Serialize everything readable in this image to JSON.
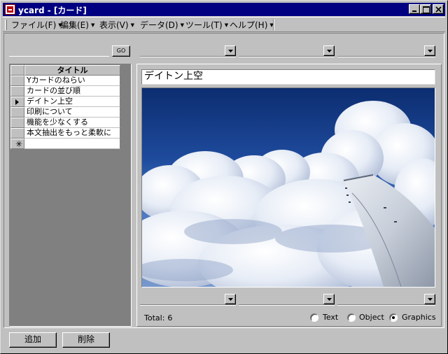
{
  "window": {
    "title": "ycard - [カード]"
  },
  "menu": {
    "items": [
      {
        "label": "ファイル(F)"
      },
      {
        "label": "編集(E)"
      },
      {
        "label": "表示(V)"
      },
      {
        "label": "データ(D)"
      },
      {
        "label": "ツール(T)"
      },
      {
        "label": "ヘルプ(H)"
      }
    ]
  },
  "search": {
    "value": "",
    "go_label": "GO"
  },
  "grid": {
    "column_header": "タイトル",
    "rows": [
      {
        "title": "Yカードのねらい"
      },
      {
        "title": "カードの並び順"
      },
      {
        "title": "デイトン上空"
      },
      {
        "title": "印刷について"
      },
      {
        "title": "機能を少なくする"
      },
      {
        "title": "本文抽出をもっと柔軟に"
      }
    ],
    "current_row": 3,
    "new_row_marker": "✳"
  },
  "detail": {
    "title_value": "デイトン上空",
    "content_type": "Graphics"
  },
  "status": {
    "total_label": "Total:",
    "total_value": "6"
  },
  "view_options": [
    {
      "label": "Text",
      "checked": false
    },
    {
      "label": "Object",
      "checked": false
    },
    {
      "label": "Graphics",
      "checked": true
    }
  ],
  "buttons": {
    "add_label": "追加",
    "delete_label": "削除"
  },
  "icons": {
    "app": "ycard-app-icon",
    "minimize": "minimize-icon",
    "maximize": "maximize-icon",
    "close": "close-icon",
    "dropdown": "chevron-down-icon",
    "current_record": "record-pointer-icon",
    "new_record": "new-record-icon"
  }
}
